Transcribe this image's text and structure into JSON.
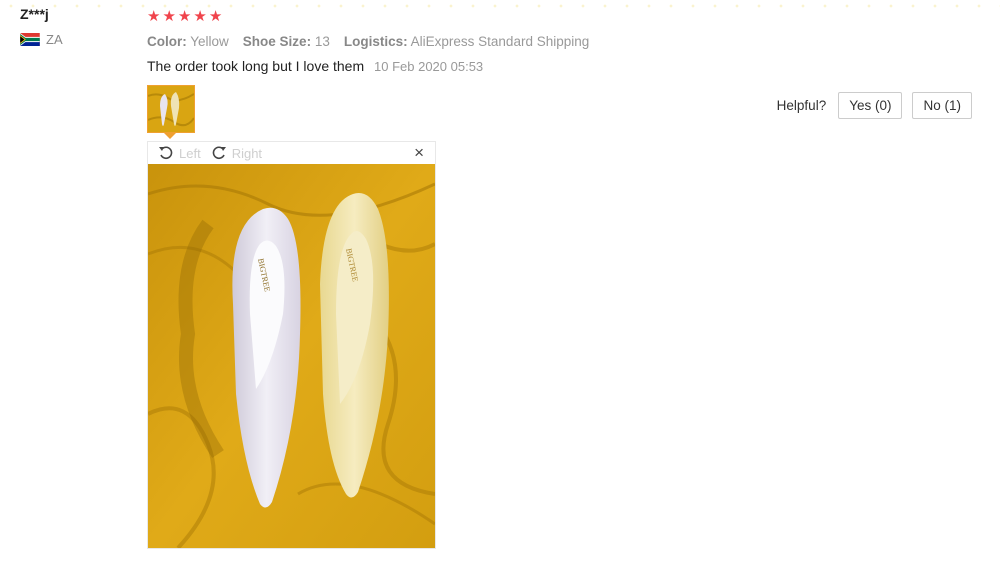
{
  "reviewer": {
    "name": "Z***j",
    "country": "ZA"
  },
  "rating": {
    "stars": 5,
    "max": 5
  },
  "attributes": [
    {
      "label": "Color:",
      "value": "Yellow"
    },
    {
      "label": "Shoe Size:",
      "value": "13"
    },
    {
      "label": "Logistics:",
      "value": "AliExpress Standard Shipping"
    }
  ],
  "feedback": {
    "text": "The order took long but I love them",
    "date": "10 Feb 2020 05:53"
  },
  "helpful": {
    "label": "Helpful?",
    "yes": "Yes (0)",
    "no": "No (1)"
  },
  "viewer": {
    "rotate_left": "Left",
    "rotate_right": "Right",
    "close": "×"
  },
  "colors": {
    "star": "#f0444c",
    "thumb_border": "#f0a030",
    "photo_bg": "#d9a512"
  }
}
